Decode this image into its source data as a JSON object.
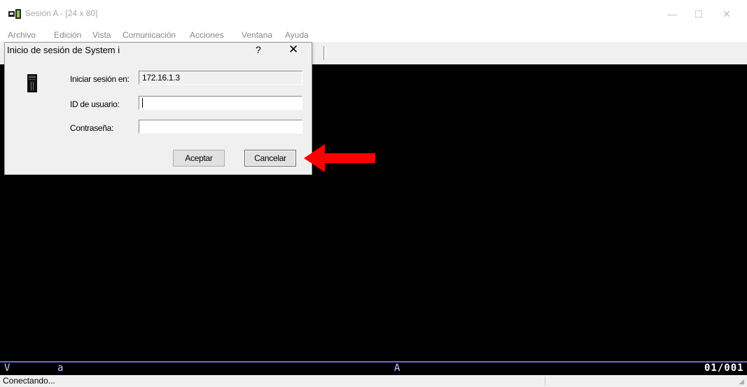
{
  "window": {
    "title": "Sesión A - [24 x 80]",
    "controls": {
      "minimize": "—",
      "maximize": "☐",
      "close": "✕"
    }
  },
  "menu": [
    "Archivo",
    "Edición",
    "Vista",
    "Comunicación",
    "Acciones",
    "Ventana",
    "Ayuda"
  ],
  "dialog": {
    "title": "Inicio de sesión de System i",
    "help": "?",
    "close": "✕",
    "fields": {
      "system": {
        "label": "Iniciar sesión en:",
        "value": "172.16.1.3"
      },
      "user": {
        "label": "ID de usuario:",
        "value": ""
      },
      "password": {
        "label": "Contraseña:",
        "value": ""
      }
    },
    "buttons": {
      "accept": "Aceptar",
      "cancel": "Cancelar"
    }
  },
  "oia": {
    "indicator_1": "V",
    "indicator_2": "a",
    "indicator_3": "A",
    "cursor_position": "01/001"
  },
  "status": {
    "text": "Conectando..."
  },
  "colors": {
    "terminal_bg": "#000000",
    "oia_line": "#6a6ad0",
    "annotation_arrow": "#ff0000"
  },
  "icons": {
    "app": "terminal-session-icon",
    "system": "system-i-server-icon",
    "annotation": "red-arrow-pointing-left"
  }
}
